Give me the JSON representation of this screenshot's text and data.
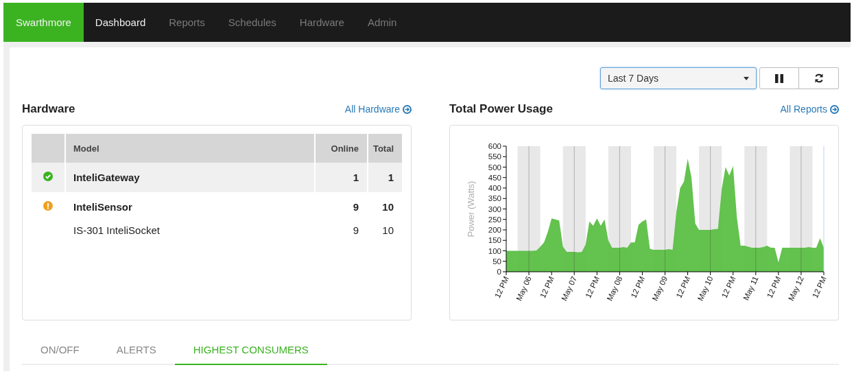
{
  "navbar": {
    "brand": "Swarthmore",
    "items": [
      {
        "label": "Dashboard",
        "selected": true
      },
      {
        "label": "Reports",
        "selected": false
      },
      {
        "label": "Schedules",
        "selected": false
      },
      {
        "label": "Hardware",
        "selected": false
      },
      {
        "label": "Admin",
        "selected": false
      }
    ]
  },
  "toolbar": {
    "range_select": {
      "value": "Last 7 Days"
    }
  },
  "hardware": {
    "title": "Hardware",
    "link": "All Hardware",
    "table": {
      "columns": [
        "Model",
        "Online",
        "Total"
      ],
      "rows": [
        {
          "kind": "ok",
          "model": "InteliGateway",
          "online": "1",
          "total": "1",
          "children": []
        },
        {
          "kind": "warning",
          "model": "InteliSensor",
          "online": "9",
          "total": "10",
          "children": [
            {
              "model": "IS-301 InteliSocket",
              "online": "9",
              "total": "10"
            }
          ]
        }
      ]
    }
  },
  "power": {
    "title": "Total Power Usage",
    "link": "All Reports",
    "chart_data": {
      "type": "area",
      "ylabel": "Power (Watts)",
      "categories": [
        "12 PM",
        null,
        null,
        null,
        null,
        null,
        "May 06",
        null,
        null,
        null,
        null,
        null,
        "12 PM",
        null,
        null,
        null,
        null,
        null,
        "May 07",
        null,
        null,
        null,
        null,
        null,
        "12 PM",
        null,
        null,
        null,
        null,
        null,
        "May 08",
        null,
        null,
        null,
        null,
        null,
        "12 PM",
        null,
        null,
        null,
        null,
        null,
        "May 09",
        null,
        null,
        null,
        null,
        null,
        "12 PM",
        null,
        null,
        null,
        null,
        null,
        "May 10",
        null,
        null,
        null,
        null,
        null,
        "12 PM",
        null,
        null,
        null,
        null,
        null,
        "May 11",
        null,
        null,
        null,
        null,
        null,
        "12 PM",
        null,
        null,
        null,
        null,
        null,
        "May 12",
        null,
        null,
        null,
        null,
        null,
        "12 PM"
      ],
      "series": [
        {
          "color": "#5cbf46",
          "values": [
            100,
            100,
            100,
            100,
            100,
            100,
            100,
            100,
            102,
            120,
            140,
            190,
            255,
            250,
            245,
            120,
            95,
            95,
            95,
            93,
            95,
            130,
            240,
            220,
            255,
            220,
            250,
            150,
            115,
            115,
            115,
            118,
            115,
            140,
            140,
            225,
            240,
            250,
            110,
            105,
            105,
            105,
            105,
            108,
            105,
            285,
            400,
            430,
            540,
            450,
            230,
            200,
            200,
            200,
            200,
            203,
            205,
            395,
            500,
            460,
            505,
            260,
            125,
            125,
            120,
            115,
            115,
            115,
            118,
            125,
            115,
            115,
            45,
            115,
            115,
            115,
            115,
            115,
            115,
            115,
            118,
            115,
            115,
            160,
            115
          ]
        }
      ],
      "ylim": [
        0,
        600
      ],
      "grid": true,
      "yticks": [
        0,
        50,
        100,
        150,
        200,
        250,
        300,
        350,
        400,
        450,
        500,
        550,
        600
      ]
    }
  },
  "tabs": [
    {
      "label": "ON/OFF",
      "selected": false
    },
    {
      "label": "ALERTS",
      "selected": false
    },
    {
      "label": "HIGHEST CONSUMERS",
      "selected": true
    }
  ]
}
